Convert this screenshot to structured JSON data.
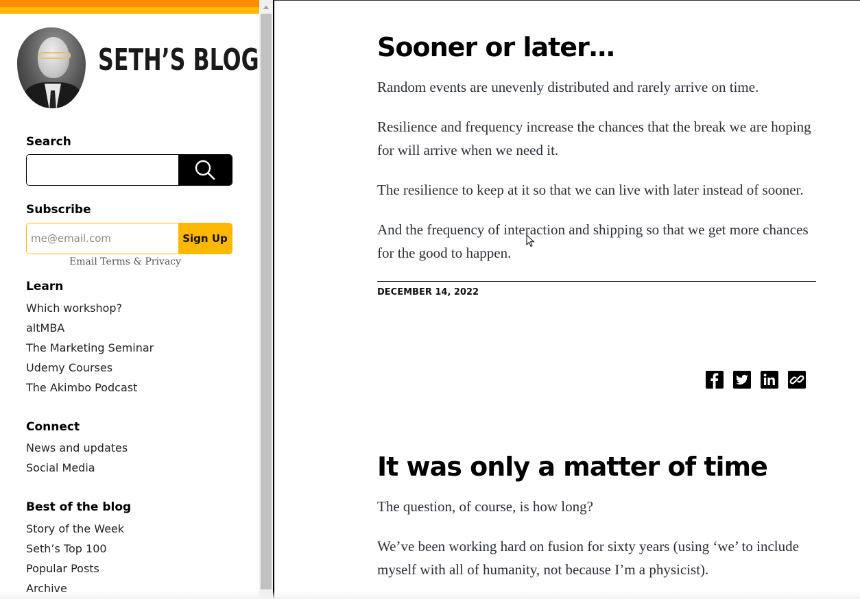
{
  "sidebar": {
    "logo_text": "SETH’S BLOG",
    "avatar_alt": "Seth portrait",
    "search": {
      "label": "Search",
      "value": "",
      "placeholder": "",
      "button_icon": "search-icon"
    },
    "subscribe": {
      "label": "Subscribe",
      "placeholder": "me@email.com",
      "button_label": "Sign Up",
      "terms_text": "Email Terms & Privacy"
    },
    "sections": [
      {
        "heading": "Learn",
        "items": [
          "Which workshop?",
          "altMBA",
          "The Marketing Seminar",
          "Udemy Courses",
          "The Akimbo Podcast"
        ]
      },
      {
        "heading": "Connect",
        "items": [
          "News and updates",
          "Social Media"
        ]
      },
      {
        "heading": "Best of the blog",
        "items": [
          "Story of the Week",
          "Seth’s Top 100",
          "Popular Posts",
          "Archive"
        ]
      }
    ]
  },
  "posts": [
    {
      "title": "Sooner or later…",
      "paragraphs": [
        "Random events are unevenly distributed and rarely arrive on time.",
        "Resilience and frequency increase the chances that the break we are hoping for will arrive when we need it.",
        "The resilience to keep at it so that we can live with later instead of sooner.",
        "And the frequency of interaction and shipping so that we get more chances for the good to happen."
      ],
      "date": "DECEMBER 14, 2022",
      "share_icons": [
        "facebook-icon",
        "twitter-icon",
        "linkedin-icon",
        "link-icon"
      ]
    },
    {
      "title": "It was only a matter of time",
      "paragraphs": [
        "The question, of course, is how long?",
        "We’ve been working hard on fusion for sixty years (using ‘we’ to include myself with all of humanity, not because I’m a physicist)."
      ]
    }
  ],
  "colors": {
    "stripe_orange": "#ff8c00",
    "stripe_yellow": "#ffb800",
    "signup_button": "#ffb800",
    "search_button": "#000000",
    "body_text": "#2a2f3a"
  }
}
